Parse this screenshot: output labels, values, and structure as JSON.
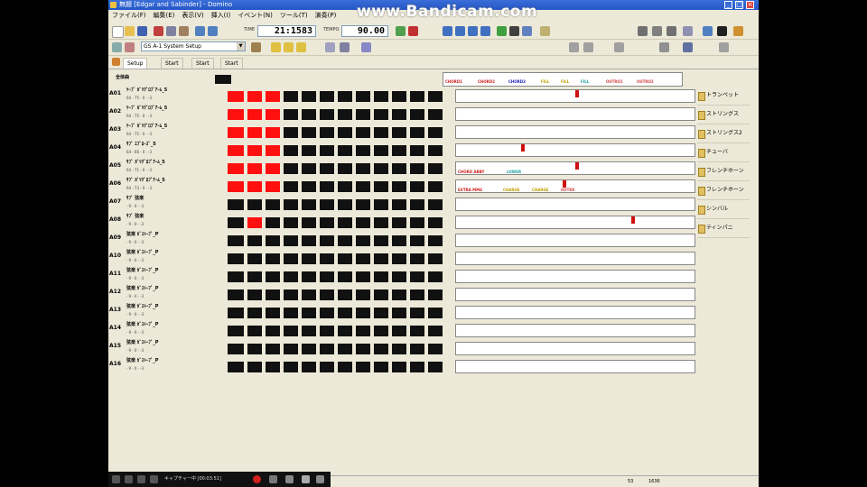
{
  "window": {
    "title": "無題 [Edgar and Sabinder] - Domino",
    "minimize": "_",
    "maximize": "□",
    "close": "×"
  },
  "overlay": {
    "watermark": "www.Bandicam.com",
    "capture_status": "キャプチャー中 [00:03:51]"
  },
  "menu": [
    "ファイル(F)",
    "編集(E)",
    "表示(V)",
    "挿入(I)",
    "イベント(N)",
    "ツール(T)",
    "演奏(P)"
  ],
  "toolbar": {
    "time_value": "21:1583",
    "tempo_label": "TEMPO",
    "tempo_value": "90.00",
    "sys_setup": "GS A-1 System Setup"
  },
  "tabs": [
    "Setup",
    "Start",
    "Start",
    "Start"
  ],
  "grid": {
    "header": "全体曲",
    "rows": [
      {
        "id": "A01",
        "name": "ｹｰﾌﾞ ｶﾞﾘｸﾞﾛﾌﾞｱｰﾑ_5",
        "sub": "64 · 75 · 0 · ·3"
      },
      {
        "id": "A02",
        "name": "ｹｰﾌﾞ ｶﾞﾘｸﾞﾛﾌﾞｱｰﾑ_5",
        "sub": "64 · 75 · 0 · ·3"
      },
      {
        "id": "A03",
        "name": "ｹｰﾌﾞ ｶﾞﾘｸﾞﾛﾌﾞｱｰﾑ_5",
        "sub": "64 · 75 · 0 · ·3"
      },
      {
        "id": "A04",
        "name": "ｻﾌﾞ ｴﾌﾞﾛｰｽﾞ_5",
        "sub": "64 · 66 · 0 · ·3"
      },
      {
        "id": "A05",
        "name": "ｻﾌﾞ ｶﾞﾘｸﾞﾛﾌﾞｱｰﾑ_5",
        "sub": "64 · 71 · 0 · ·3"
      },
      {
        "id": "A06",
        "name": "ｻﾌﾞ ｶﾞﾘｸﾞﾛﾌﾞｱｰﾑ_5",
        "sub": "64 · 73 · 0 · ·3"
      },
      {
        "id": "A07",
        "name": "ｻﾌﾞ 弦楽",
        "sub": "· 9 · 0 · ·3"
      },
      {
        "id": "A08",
        "name": "ｻﾌﾞ 弦楽",
        "sub": "· 9 · 0 · ·3"
      },
      {
        "id": "A09",
        "name": "弦楽 ｶﾞｽﾄｰﾌﾞ_P",
        "sub": "· 9 · 0 · ·3"
      },
      {
        "id": "A10",
        "name": "弦楽 ｶﾞｽﾄｰﾌﾞ_P",
        "sub": "· 9 · 0 · ·3"
      },
      {
        "id": "A11",
        "name": "弦楽 ｶﾞｽﾄｰﾌﾞ_P",
        "sub": "· 9 · 0 · ·3"
      },
      {
        "id": "A12",
        "name": "弦楽 ｶﾞｽﾄｰﾌﾞ_P",
        "sub": "· 9 · 0 · ·3"
      },
      {
        "id": "A13",
        "name": "弦楽 ｶﾞｽﾄｰﾌﾞ_P",
        "sub": "· 9 · 0 · ·3"
      },
      {
        "id": "A14",
        "name": "弦楽 ｶﾞｽﾄｰﾌﾞ_P",
        "sub": "· 9 · 0 · ·3"
      },
      {
        "id": "A15",
        "name": "弦楽 ｶﾞｽﾄｰﾌﾞ_P",
        "sub": "· 9 · 0 · ·3"
      },
      {
        "id": "A16",
        "name": "弦楽 ｶﾞｽﾄｰﾌﾞ_P",
        "sub": "· 9 · 0 · ·3"
      }
    ],
    "row5_labels": [
      "CHORD ABBY",
      "LOWER"
    ],
    "row6_labels": [
      "EXTRA MM4",
      "CHARGE",
      "CHARGE",
      "OUTER"
    ],
    "head_labels": [
      "CHORD1",
      "CHORD2",
      "CHORD3",
      "FILL",
      "FILL",
      "FILL",
      "OUTRO1",
      "OUTRO2"
    ]
  },
  "instruments": [
    "トランペット",
    "ストリングス",
    "ストリングス2",
    "チューバ",
    "フレンチホーン",
    "フレンチホーン",
    "シンバル",
    "ティンパニ"
  ],
  "statusbar": {
    "pos": "53",
    "count": "1636"
  },
  "colors": {
    "active": "#ff1010",
    "titlebar": "#2456c6",
    "face": "#ece9d8"
  }
}
